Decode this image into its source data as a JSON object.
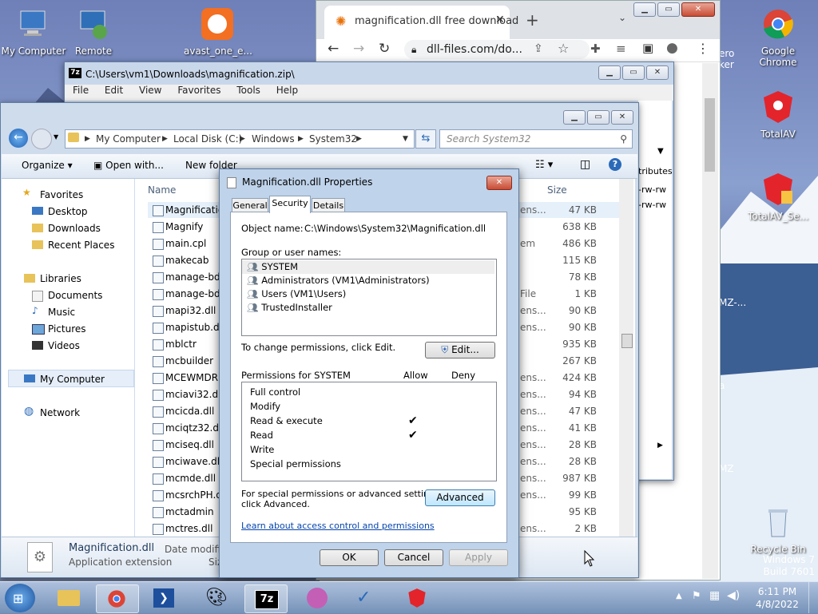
{
  "desktop": {
    "icons": [
      {
        "label": "My Computer"
      },
      {
        "label": "Remote"
      },
      {
        "label": "avast_one_e..."
      },
      {
        "label": "Google Chrome"
      },
      {
        "label": "TotalAV"
      },
      {
        "label": "TotalAV_Se..."
      },
      {
        "label": "Recycle Bin"
      }
    ],
    "partial_labels": [
      "ero",
      "ker",
      "MZ-...",
      "a",
      "MZ"
    ],
    "watermark": {
      "line1": "Windows 7",
      "line2": "Build 7601"
    }
  },
  "chrome": {
    "tab_title": "magnification.dll free download",
    "url": "dll-files.com/do..."
  },
  "sevenzip": {
    "title": "C:\\Users\\vm1\\Downloads\\magnification.zip\\",
    "menu": [
      "File",
      "Edit",
      "View",
      "Favorites",
      "Tools",
      "Help"
    ],
    "col_attributes": "tributes",
    "attr_values": [
      "-rw-rw",
      "-rw-rw"
    ]
  },
  "explorer": {
    "breadcrumb": [
      "My Computer",
      "Local Disk (C:)",
      "Windows",
      "System32"
    ],
    "search_placeholder": "Search System32",
    "toolbar": {
      "organize": "Organize",
      "open_with": "Open with...",
      "new_folder": "New folder"
    },
    "nav": {
      "favorites": "Favorites",
      "desktop": "Desktop",
      "downloads": "Downloads",
      "recent": "Recent Places",
      "libraries": "Libraries",
      "documents": "Documents",
      "music": "Music",
      "pictures": "Pictures",
      "videos": "Videos",
      "computer": "My Computer",
      "network": "Network"
    },
    "columns": {
      "name": "Name",
      "size": "Size"
    },
    "files": [
      {
        "name": "Magnificatio",
        "type": "ens...",
        "size": "47 KB"
      },
      {
        "name": "Magnify",
        "type": "",
        "size": "638 KB"
      },
      {
        "name": "main.cpl",
        "type": "em",
        "size": "486 KB"
      },
      {
        "name": "makecab",
        "type": "",
        "size": "115 KB"
      },
      {
        "name": "manage-bde",
        "type": "",
        "size": "78 KB"
      },
      {
        "name": "manage-bde",
        "type": "File",
        "size": "1 KB"
      },
      {
        "name": "mapi32.dll",
        "type": "ens...",
        "size": "90 KB"
      },
      {
        "name": "mapistub.dll",
        "type": "ens...",
        "size": "90 KB"
      },
      {
        "name": "mblctr",
        "type": "",
        "size": "935 KB"
      },
      {
        "name": "mcbuilder",
        "type": "",
        "size": "267 KB"
      },
      {
        "name": "MCEWMDRM",
        "type": "ens...",
        "size": "424 KB"
      },
      {
        "name": "mciavi32.dll",
        "type": "ens...",
        "size": "94 KB"
      },
      {
        "name": "mcicda.dll",
        "type": "ens...",
        "size": "47 KB"
      },
      {
        "name": "mciqtz32.dll",
        "type": "ens...",
        "size": "41 KB"
      },
      {
        "name": "mciseq.dll",
        "type": "ens...",
        "size": "28 KB"
      },
      {
        "name": "mciwave.dll",
        "type": "ens...",
        "size": "28 KB"
      },
      {
        "name": "mcmde.dll",
        "type": "ens...",
        "size": "987 KB"
      },
      {
        "name": "mcsrchPH.dll",
        "type": "ens...",
        "size": "99 KB"
      },
      {
        "name": "mctadmin",
        "type": "",
        "size": "95 KB"
      },
      {
        "name": "mctres.dll",
        "type": "ens...",
        "size": "2 KB"
      }
    ],
    "details": {
      "name": "Magnification.dll",
      "type": "Application extension",
      "date_label": "Date modifie",
      "size_label": "Siz"
    }
  },
  "dialog": {
    "title": "Magnification.dll Properties",
    "tabs": [
      "General",
      "Security",
      "Details"
    ],
    "object_label": "Object name:",
    "object_value": "C:\\Windows\\System32\\Magnification.dll",
    "group_label": "Group or user names:",
    "users": [
      "SYSTEM",
      "Administrators (VM1\\Administrators)",
      "Users (VM1\\Users)",
      "TrustedInstaller"
    ],
    "change_text": "To change permissions, click Edit.",
    "edit_button": "Edit...",
    "perm_header": "Permissions for SYSTEM",
    "allow": "Allow",
    "deny": "Deny",
    "permissions": [
      {
        "name": "Full control",
        "allow": ""
      },
      {
        "name": "Modify",
        "allow": ""
      },
      {
        "name": "Read & execute",
        "allow": "✔"
      },
      {
        "name": "Read",
        "allow": "✔"
      },
      {
        "name": "Write",
        "allow": ""
      },
      {
        "name": "Special permissions",
        "allow": ""
      }
    ],
    "special_text_1": "For special permissions or advanced settings,",
    "special_text_2": "click Advanced.",
    "advanced_button": "Advanced",
    "learn_link": "Learn about access control and permissions",
    "ok": "OK",
    "cancel": "Cancel",
    "apply": "Apply"
  },
  "taskbar": {
    "time": "6:11 PM",
    "date": "4/8/2022",
    "sevenzip_label": "7z"
  }
}
